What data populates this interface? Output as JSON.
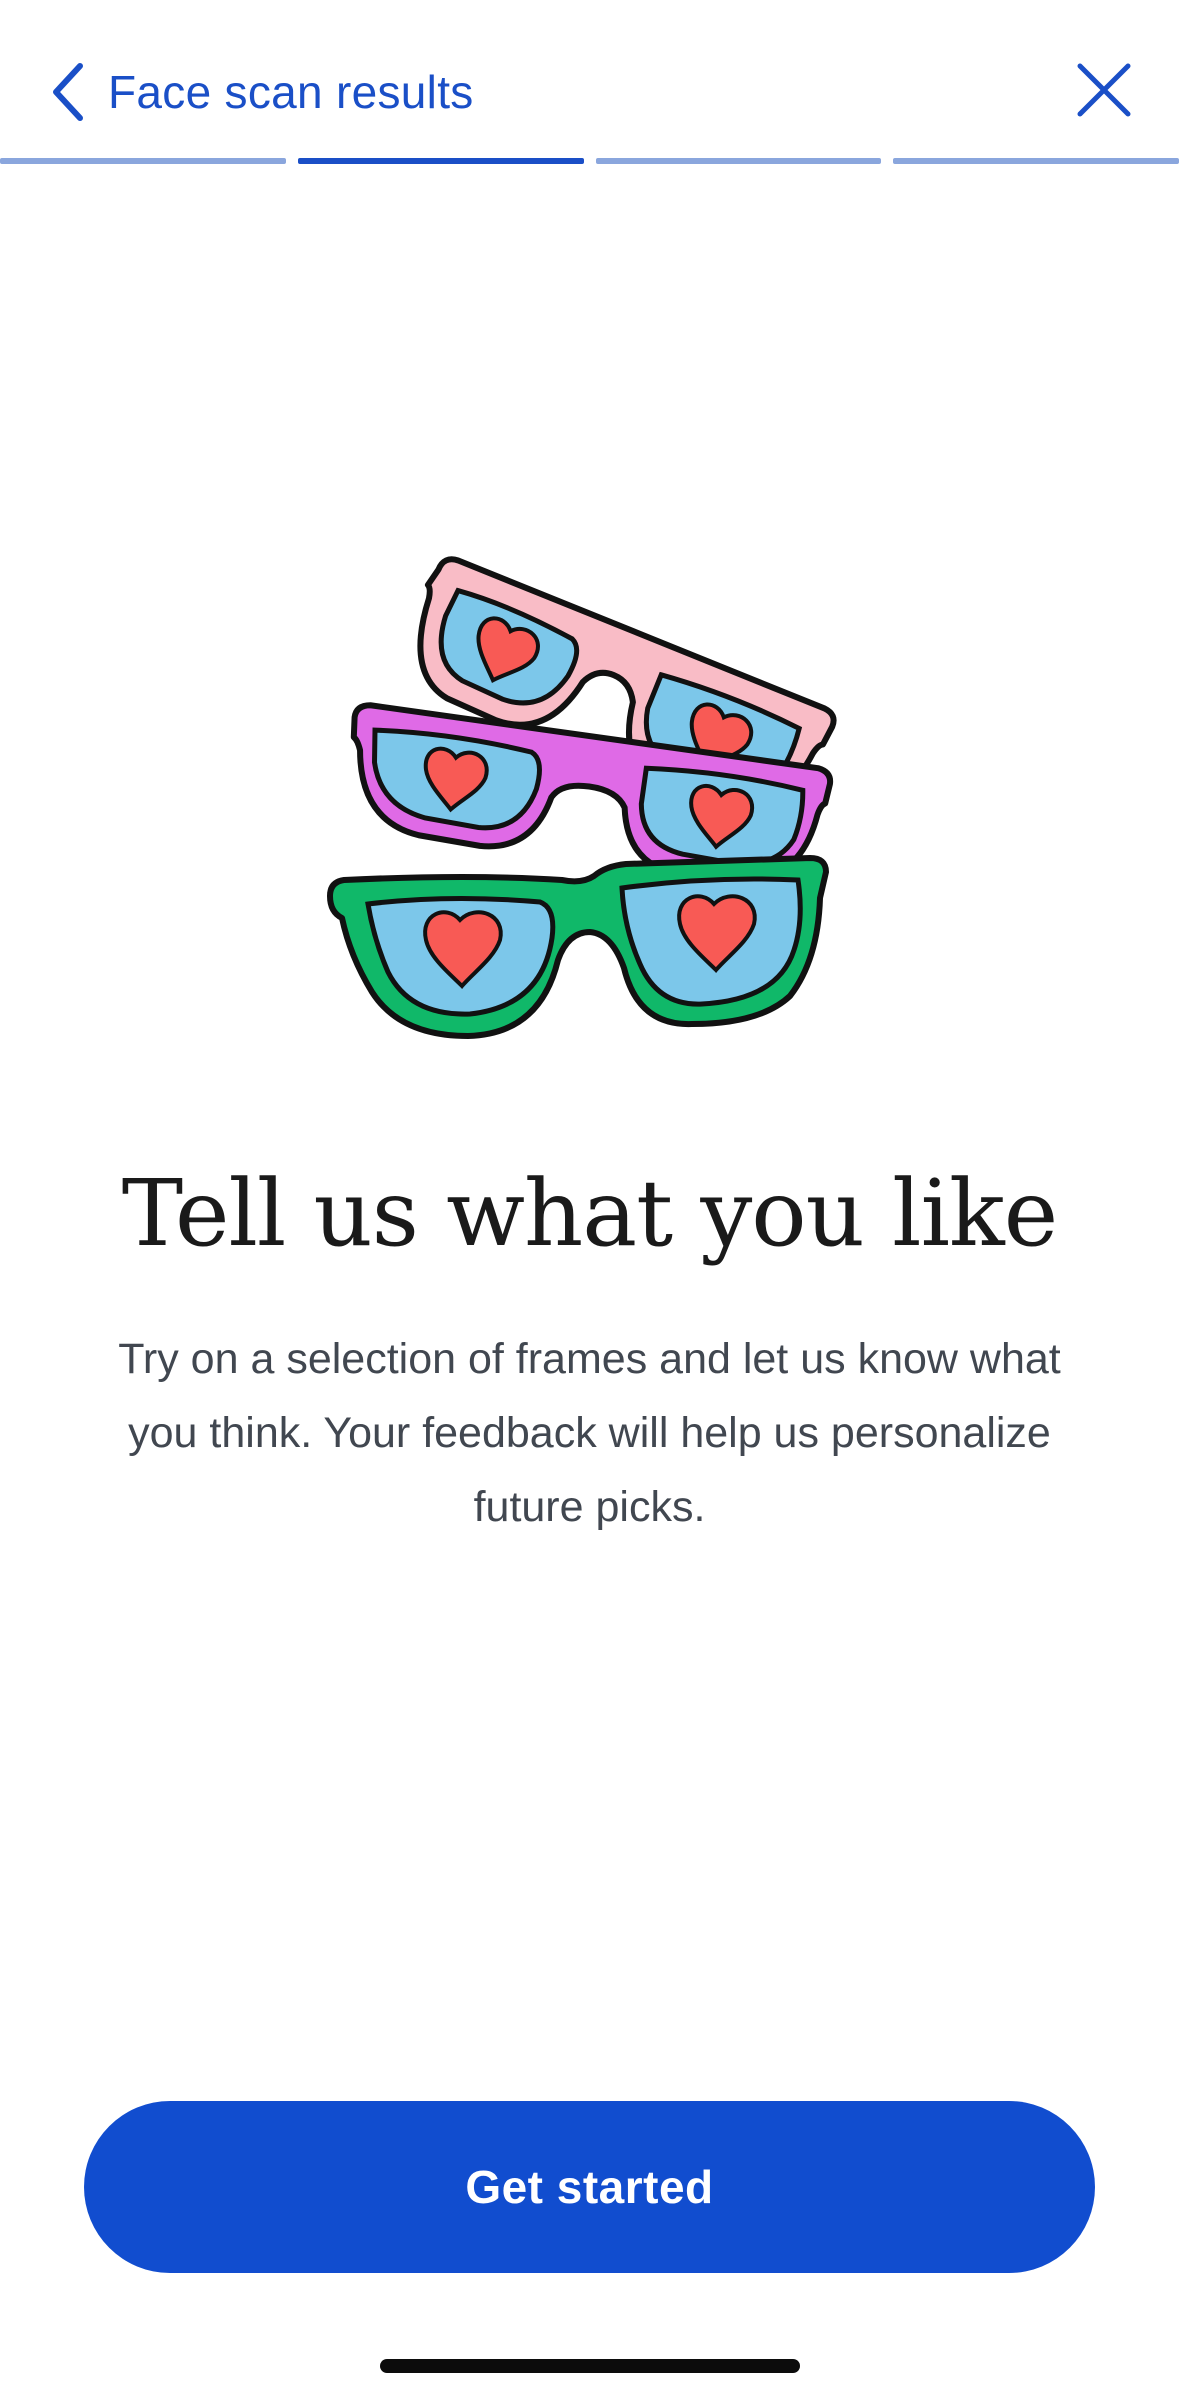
{
  "header": {
    "back_label": "Face scan results",
    "back_icon": "chevron-left-icon",
    "close_icon": "close-icon"
  },
  "progress": {
    "total_steps": 4,
    "current_step": 2,
    "active_color": "#1a4fc7",
    "inactive_color": "#8aa6dd"
  },
  "illustration": {
    "name": "sunglasses-hearts-illustration",
    "colors": {
      "frame_top": "#f9bcc6",
      "frame_middle": "#df6ae6",
      "frame_bottom": "#10b869",
      "lens": "#7cc7ea",
      "heart": "#f85a55",
      "outline": "#111111"
    }
  },
  "main": {
    "title": "Tell us what you like",
    "description": "Try on a selection of frames and let us know what you think. Your feedback will help us personalize future picks."
  },
  "cta": {
    "label": "Get started",
    "color": "#114dcf"
  }
}
